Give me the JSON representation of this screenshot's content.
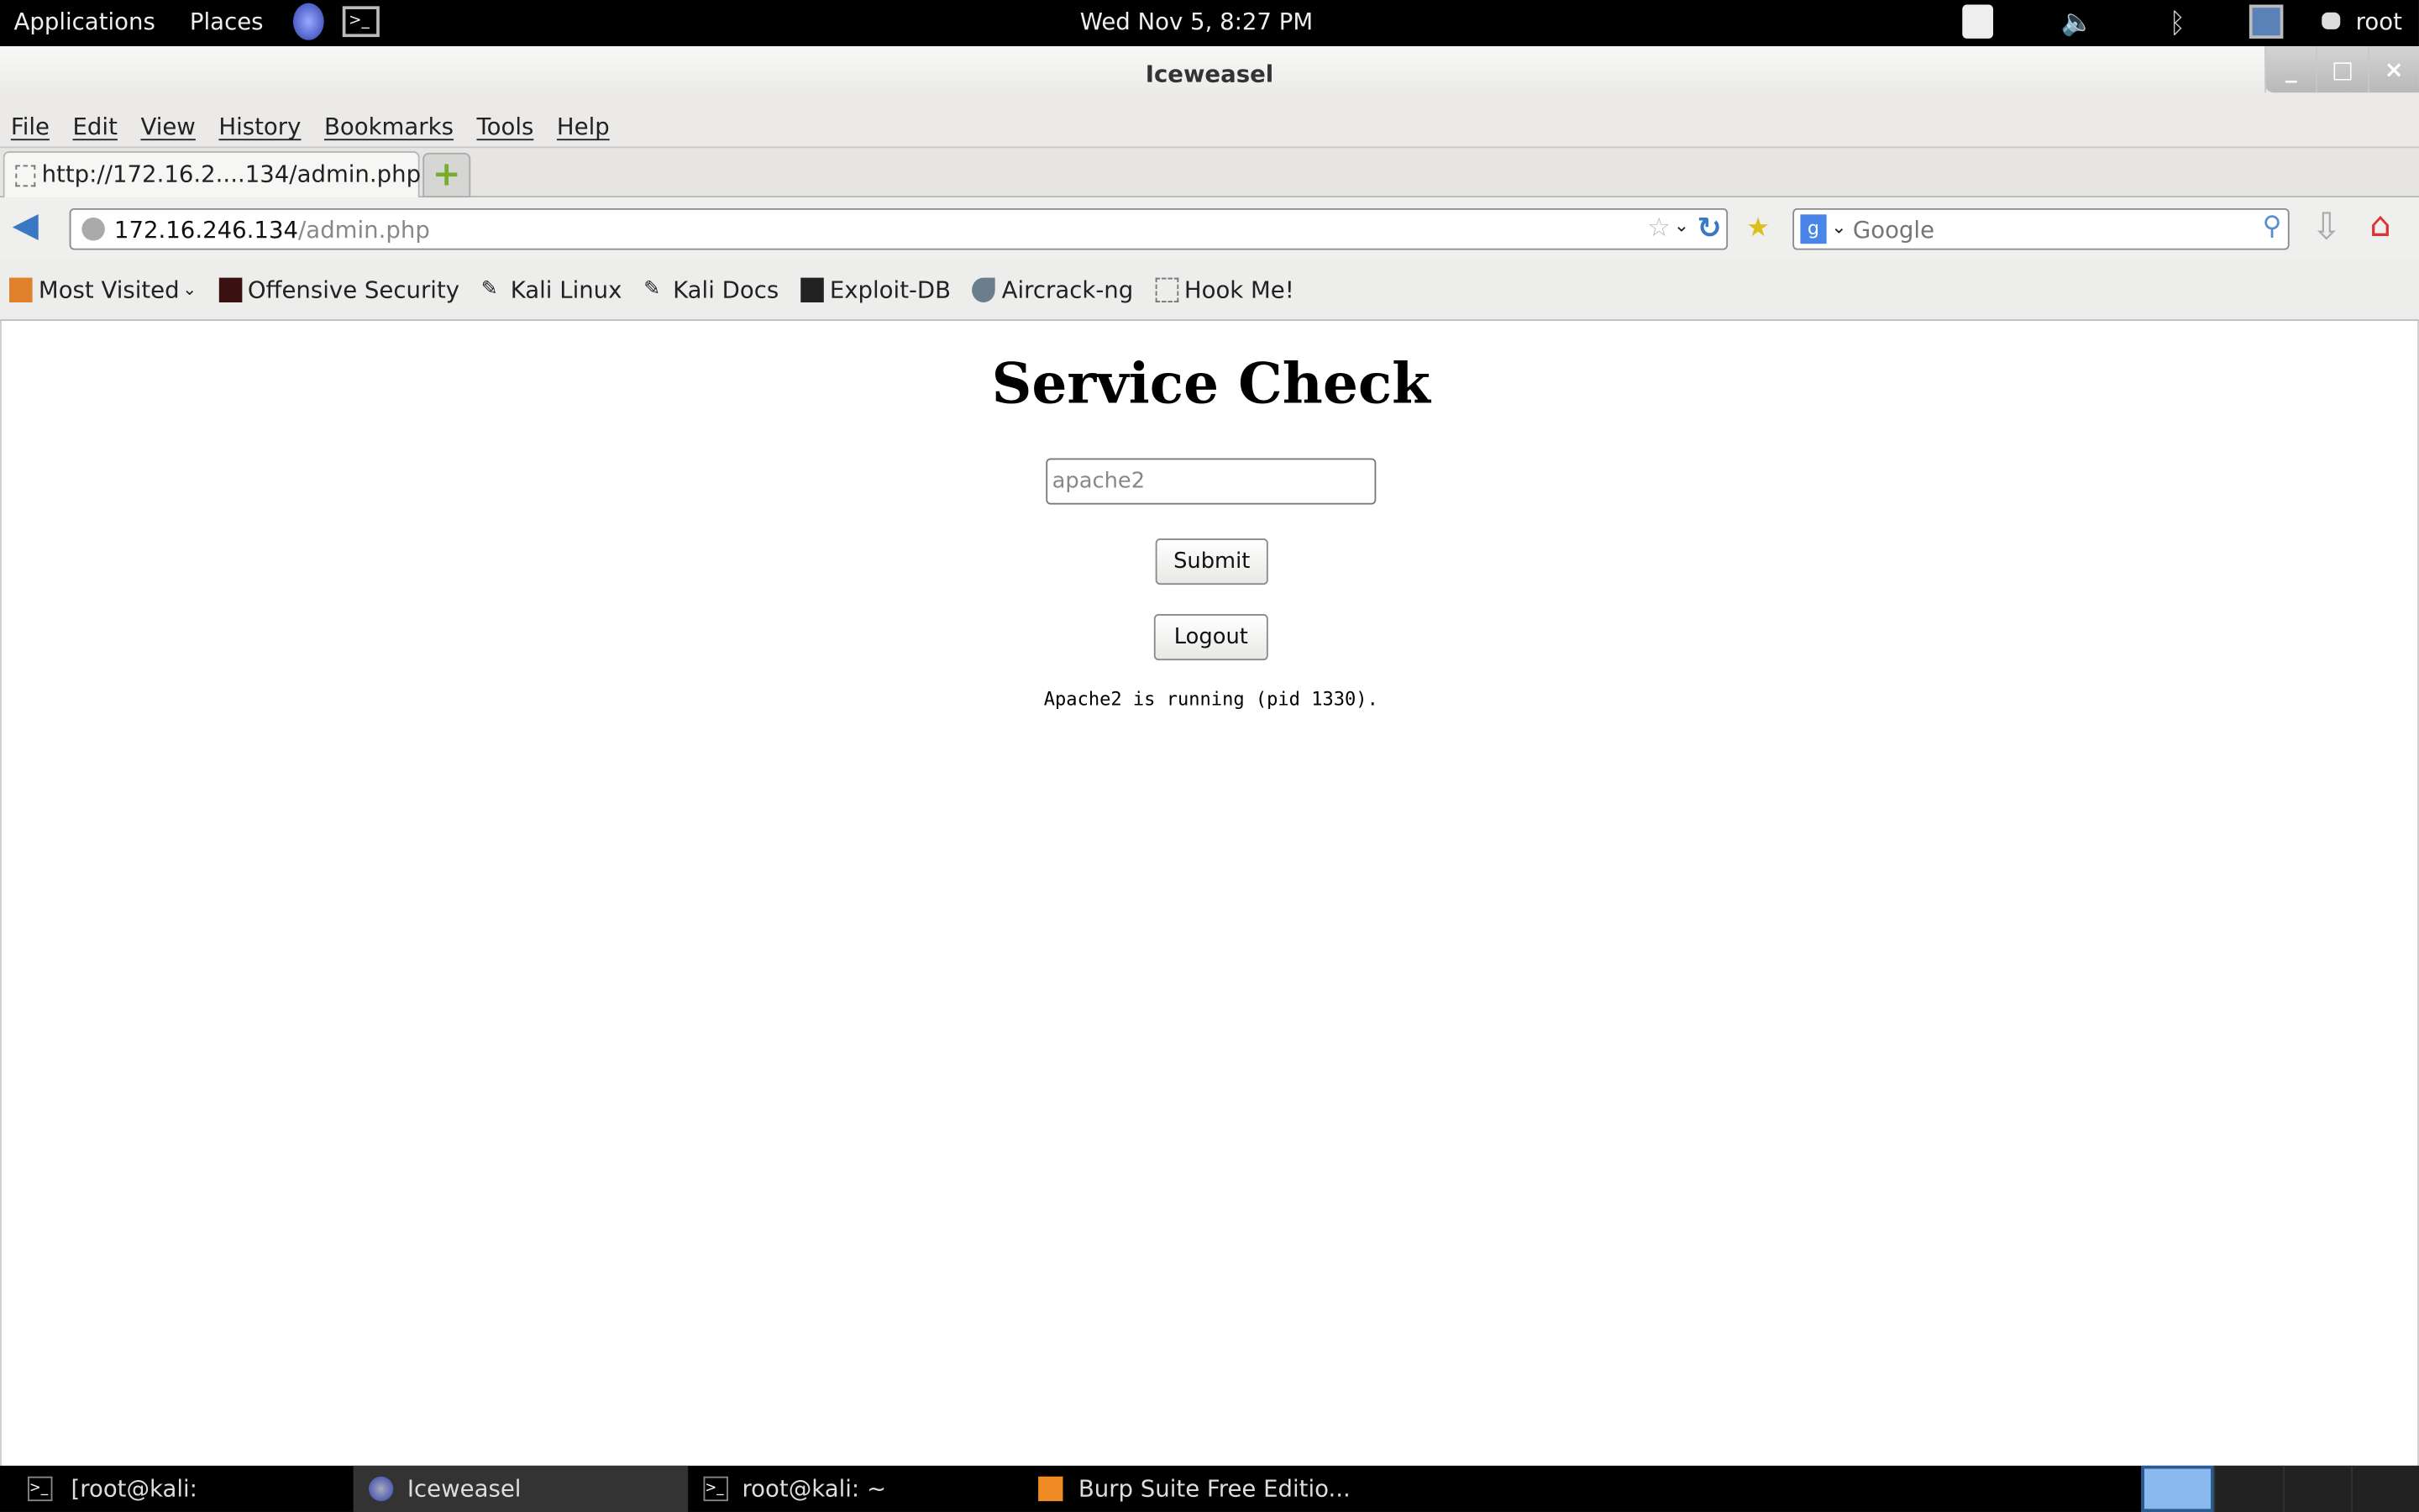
{
  "top_panel": {
    "applications": "Applications",
    "places": "Places",
    "clock": "Wed Nov  5,  8:27 PM",
    "user": "root",
    "icons": [
      "iceweasel-icon",
      "terminal-icon",
      "notification-icon",
      "volume-muted-icon",
      "bluetooth-icon",
      "network-icon",
      "chat-icon"
    ]
  },
  "window": {
    "title": "Iceweasel",
    "controls": [
      "_",
      "□",
      "×"
    ]
  },
  "menu": [
    "File",
    "Edit",
    "View",
    "History",
    "Bookmarks",
    "Tools",
    "Help"
  ],
  "tab": {
    "label": "http://172.16.2....134/admin.php",
    "new_tab": "+"
  },
  "navbar": {
    "url_host": "172.16.246.134",
    "url_path": "/admin.php",
    "search_placeholder": "Google"
  },
  "bookmarks": [
    "Most Visited",
    "Offensive Security",
    "Kali Linux",
    "Kali Docs",
    "Exploit-DB",
    "Aircrack-ng",
    "Hook Me!"
  ],
  "page": {
    "heading": "Service Check",
    "input_placeholder": "apache2",
    "submit": "Submit",
    "logout": "Logout",
    "status": "Apache2 is running (pid 1330)."
  },
  "taskbar": {
    "items": [
      "[root@kali: ~/data/scri...",
      "Iceweasel",
      "root@kali: ~",
      "Burp Suite Free Editio..."
    ],
    "active": "Iceweasel"
  },
  "colors": {
    "panel": "#000000",
    "accent_blue": "#3b78c4",
    "workspace_active": "#89b9ee"
  }
}
